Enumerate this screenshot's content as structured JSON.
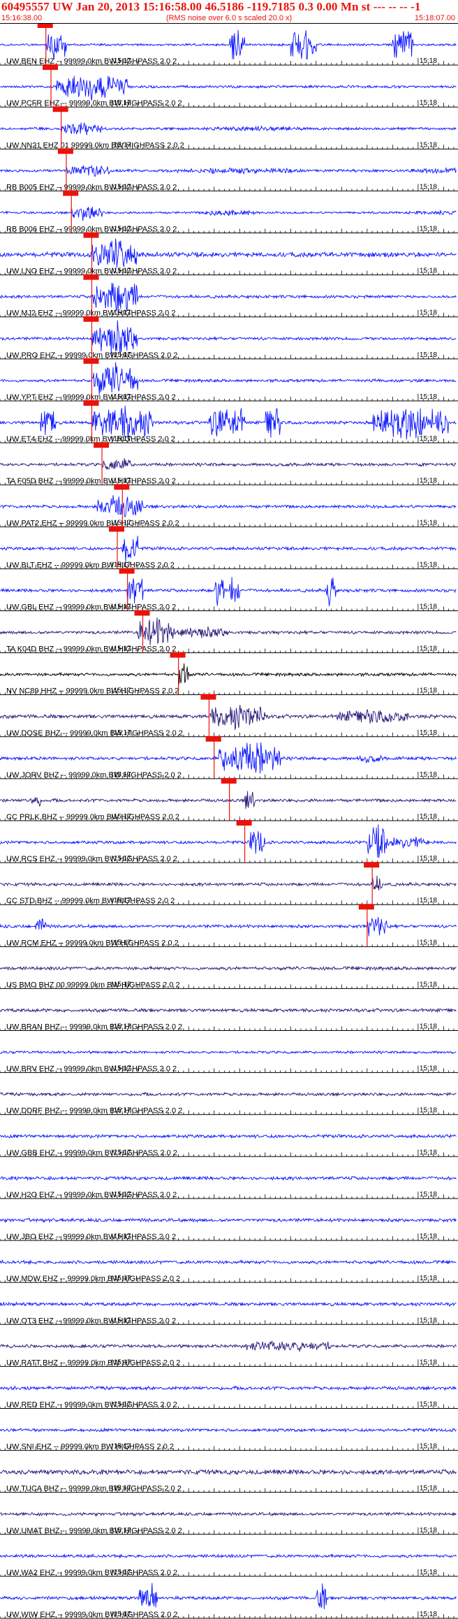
{
  "header": {
    "title": "60495557 UW Jan 20, 2013 15:16:58.00   46.5186 -119.7185  0.3 0.00 Mn st --- -- -- -1",
    "subtitle": "(RMS noise over 6.0 s scaled 20.0 x)",
    "time_left": "15:16:38.00",
    "time_right": "15:18:07.00"
  },
  "plot": {
    "start_time": "15:16:38.00",
    "end_time": "15:18:07.00",
    "minor_tick_seconds": 1,
    "major_tick_seconds": 5,
    "minute_labels": [
      "15:17",
      "15:18"
    ],
    "colors": {
      "blue": "#0a14ff",
      "navy": "#281478",
      "black": "#000000",
      "pick": "#e8140c",
      "header": "#e8140c"
    }
  },
  "traces": [
    {
      "label": "UW BEN EHZ -- 99999.0km BW  HIGHPASS  2.0  2",
      "color": "blue",
      "amp": 0.22,
      "pick": 9,
      "bursts": [
        [
          9,
          13,
          3.5
        ],
        [
          45,
          48,
          3.5
        ],
        [
          57,
          62,
          3.5
        ],
        [
          77,
          81,
          3.5
        ],
        [
          111,
          113,
          2
        ],
        [
          164,
          168,
          3.5
        ]
      ]
    },
    {
      "label": "UW PCFR EHZ -- 99999.0km BW  HIGHPASS  2.0  2",
      "color": "blue",
      "amp": 0.25,
      "pick": 10,
      "bursts": [
        [
          11,
          25,
          2.6
        ]
      ]
    },
    {
      "label": "UW NN21 EHZ 01 99999.0km BW  HIGHPASS  2.0  2",
      "color": "blue",
      "amp": 0.25,
      "pick": 12,
      "bursts": [
        [
          12,
          20,
          1.4
        ],
        [
          40,
          60,
          0.5
        ],
        [
          95,
          130,
          0.4
        ]
      ]
    },
    {
      "label": "RB B005 EHZ -- 99999.0km BW  HIGHPASS  2.0  2",
      "color": "blue",
      "amp": 0.26,
      "pick": 13,
      "bursts": [
        [
          13,
          22,
          1.2
        ],
        [
          34,
          60,
          0.6
        ],
        [
          80,
          100,
          0.6
        ]
      ]
    },
    {
      "label": "RB B006 EHZ -- 99999.0km BW  HIGHPASS  2.0  2",
      "color": "blue",
      "amp": 0.22,
      "pick": 14,
      "bursts": [
        [
          14,
          20,
          1.6
        ],
        [
          40,
          50,
          0.7
        ],
        [
          80,
          100,
          0.5
        ],
        [
          130,
          150,
          0.5
        ]
      ]
    },
    {
      "label": "UW LNO EHZ -- 99999.0km BW  HIGHPASS  2.0  2",
      "color": "blue",
      "amp": 0.45,
      "pick": 18,
      "bursts": [
        [
          18,
          27,
          3.5
        ]
      ]
    },
    {
      "label": "UW MJ2 EHZ -- 99999.0km BW  HIGHPASS  2.0  2",
      "color": "blue",
      "amp": 0.28,
      "pick": 18,
      "bursts": [
        [
          18,
          27,
          3.5
        ]
      ]
    },
    {
      "label": "UW PRO EHZ -- 99999.0km BW  HIGHPASS  2.0  2",
      "color": "blue",
      "amp": 0.28,
      "pick": 18,
      "bursts": [
        [
          18,
          27,
          3.5
        ]
      ]
    },
    {
      "label": "UW YPT EHZ -- 99999.0km BW  HIGHPASS  2.0  2",
      "color": "blue",
      "amp": 0.28,
      "pick": 18,
      "bursts": [
        [
          18,
          27,
          3.5
        ]
      ]
    },
    {
      "label": "UW ET4 EHZ -- 99999.0km BW  HIGHPASS  2.0  2",
      "color": "blue",
      "amp": 0.3,
      "pick": 18,
      "bursts": [
        [
          8,
          11,
          3.5
        ],
        [
          18,
          30,
          3.5
        ],
        [
          41,
          48,
          3.5
        ],
        [
          52,
          55,
          3.5
        ],
        [
          73,
          88,
          3.5
        ]
      ]
    },
    {
      "label": "TA F05D BHZ -- 99999.0km BW  HIGHPASS  2.0  2",
      "color": "navy",
      "amp": 0.3,
      "pick": 20,
      "bursts": [
        [
          20,
          26,
          1.4
        ]
      ]
    },
    {
      "label": "UW PAT2 EHZ -- 99999.0km BW  HIGHPASS  2.0  2",
      "color": "blue",
      "amp": 0.3,
      "pick": 24,
      "bursts": [
        [
          19,
          28,
          2.4
        ]
      ]
    },
    {
      "label": "UW BLT EHZ -- 99999.0km BW  HIGHPASS  2.0  2",
      "color": "blue",
      "amp": 0.3,
      "pick": 23,
      "bursts": [
        [
          24,
          27,
          3.5
        ]
      ]
    },
    {
      "label": "UW GBL EHZ -- 99999.0km BW  HIGHPASS  2.0  2",
      "color": "blue",
      "amp": 0.3,
      "pick": 25,
      "bursts": [
        [
          25,
          28,
          3.5
        ],
        [
          42,
          44,
          3.5
        ],
        [
          45,
          47,
          3.5
        ],
        [
          64,
          66,
          3.5
        ]
      ]
    },
    {
      "label": "TA K04D BHZ -- 99999.0km BW  HIGHPASS  2.0  2",
      "color": "navy",
      "amp": 0.3,
      "pick": 28,
      "bursts": [
        [
          27,
          34,
          3
        ],
        [
          34,
          45,
          1.2
        ]
      ]
    },
    {
      "label": "NV NC89 HHZ -- 99999.0km BW  HIGHPASS  2.0  2",
      "color": "black",
      "amp": 0.3,
      "pick": 35,
      "bursts": [
        [
          35,
          37,
          3.5
        ]
      ]
    },
    {
      "label": "UW DOSE BHZ -- 99999.0km BW  HIGHPASS  2.0  2",
      "color": "navy",
      "amp": 0.35,
      "pick": 41,
      "bursts": [
        [
          41,
          52,
          2.5
        ],
        [
          66,
          80,
          1.4
        ]
      ]
    },
    {
      "label": "UW JORV BHZ -- 99999.0km BW  HIGHPASS  2.0  2",
      "color": "blue",
      "amp": 0.32,
      "pick": 42,
      "bursts": [
        [
          43,
          55,
          3.5
        ],
        [
          70,
          75,
          0.8
        ]
      ]
    },
    {
      "label": "CC PRLK BHZ -- 99999.0km BW  HIGHPASS  2.0  2",
      "color": "navy",
      "amp": 0.3,
      "pick": 45,
      "bursts": [
        [
          6,
          8,
          1.5
        ],
        [
          48,
          50,
          2.5
        ]
      ]
    },
    {
      "label": "UW RCS EHZ -- 99999.0km BW  HIGHPASS  2.0  2",
      "color": "blue",
      "amp": 0.3,
      "pick": 48,
      "bursts": [
        [
          49,
          52,
          3
        ],
        [
          72,
          76,
          3.5
        ],
        [
          76,
          84,
          1.2
        ]
      ]
    },
    {
      "label": "CC STD BHZ -- 99999.0km BW  HIGHPASS  2.0  2",
      "color": "navy",
      "amp": 0.3,
      "pick": 73,
      "bursts": [
        [
          73,
          75,
          2
        ]
      ]
    },
    {
      "label": "UW RCM EHZ -- 99999.0km BW  HIGHPASS  2.0  2",
      "color": "blue",
      "amp": 0.3,
      "pick": 72,
      "bursts": [
        [
          7,
          9,
          1.8
        ],
        [
          72,
          76,
          2.4
        ]
      ]
    },
    {
      "label": "US BMO BHZ 00 99999.0km BW  HIGHPASS  2.0  2",
      "color": "navy",
      "amp": 0.32,
      "pick": null,
      "bursts": []
    },
    {
      "label": "UW BRAN BHZ -- 99999.0km BW  HIGHPASS  2.0  2",
      "color": "navy",
      "amp": 0.32,
      "pick": null,
      "bursts": []
    },
    {
      "label": "UW BRV EHZ -- 99999.0km BW  HIGHPASS  2.0  2",
      "color": "blue",
      "amp": 0.25,
      "pick": null,
      "bursts": []
    },
    {
      "label": "UW DDRF BHZ -- 99999.0km BW  HIGHPASS  2.0  2",
      "color": "navy",
      "amp": 0.3,
      "pick": null,
      "bursts": []
    },
    {
      "label": "UW GBB EHZ -- 99999.0km BW  HIGHPASS  2.0  2",
      "color": "blue",
      "amp": 0.32,
      "pick": null,
      "bursts": []
    },
    {
      "label": "UW H2O EHZ -- 99999.0km BW  HIGHPASS  2.0  2",
      "color": "blue",
      "amp": 0.32,
      "pick": null,
      "bursts": []
    },
    {
      "label": "UW JBO EHZ -- 99999.0km BW  HIGHPASS  2.0  2",
      "color": "blue",
      "amp": 0.32,
      "pick": null,
      "bursts": []
    },
    {
      "label": "UW MDW EHZ -- 99999.0km BW  HIGHPASS  2.0  2",
      "color": "blue",
      "amp": 0.32,
      "pick": null,
      "bursts": []
    },
    {
      "label": "UW OT3 EHZ -- 99999.0km BW  HIGHPASS  2.0  2",
      "color": "blue",
      "amp": 0.32,
      "pick": null,
      "bursts": []
    },
    {
      "label": "UW RATT BHZ -- 99999.0km BW  HIGHPASS  2.0  2",
      "color": "navy",
      "amp": 0.3,
      "pick": null,
      "bursts": [
        [
          47,
          65,
          1.2
        ]
      ]
    },
    {
      "label": "UW RED EHZ -- 99999.0km BW  HIGHPASS  2.0  2",
      "color": "blue",
      "amp": 0.32,
      "pick": null,
      "bursts": []
    },
    {
      "label": "UW SNI EHZ -- 99999.0km BW  HIGHPASS  2.0  2",
      "color": "blue",
      "amp": 0.3,
      "pick": null,
      "bursts": []
    },
    {
      "label": "UW TUCA BHZ -- 99999.0km BW  HIGHPASS  2.0  2",
      "color": "navy",
      "amp": 0.45,
      "pick": null,
      "bursts": []
    },
    {
      "label": "UW UMAT BHZ -- 99999.0km BW  HIGHPASS  2.0  2",
      "color": "navy",
      "amp": 0.3,
      "pick": null,
      "bursts": []
    },
    {
      "label": "UW WA2 EHZ -- 99999.0km BW  HIGHPASS  2.0  2",
      "color": "blue",
      "amp": 0.3,
      "pick": null,
      "bursts": []
    },
    {
      "label": "UW WIW EHZ -- 99999.0km BW  HIGHPASS  2.0  2",
      "color": "blue",
      "amp": 0.3,
      "pick": null,
      "bursts": [
        [
          27,
          28,
          3
        ],
        [
          28,
          31,
          3
        ],
        [
          62,
          64,
          3
        ]
      ]
    }
  ]
}
